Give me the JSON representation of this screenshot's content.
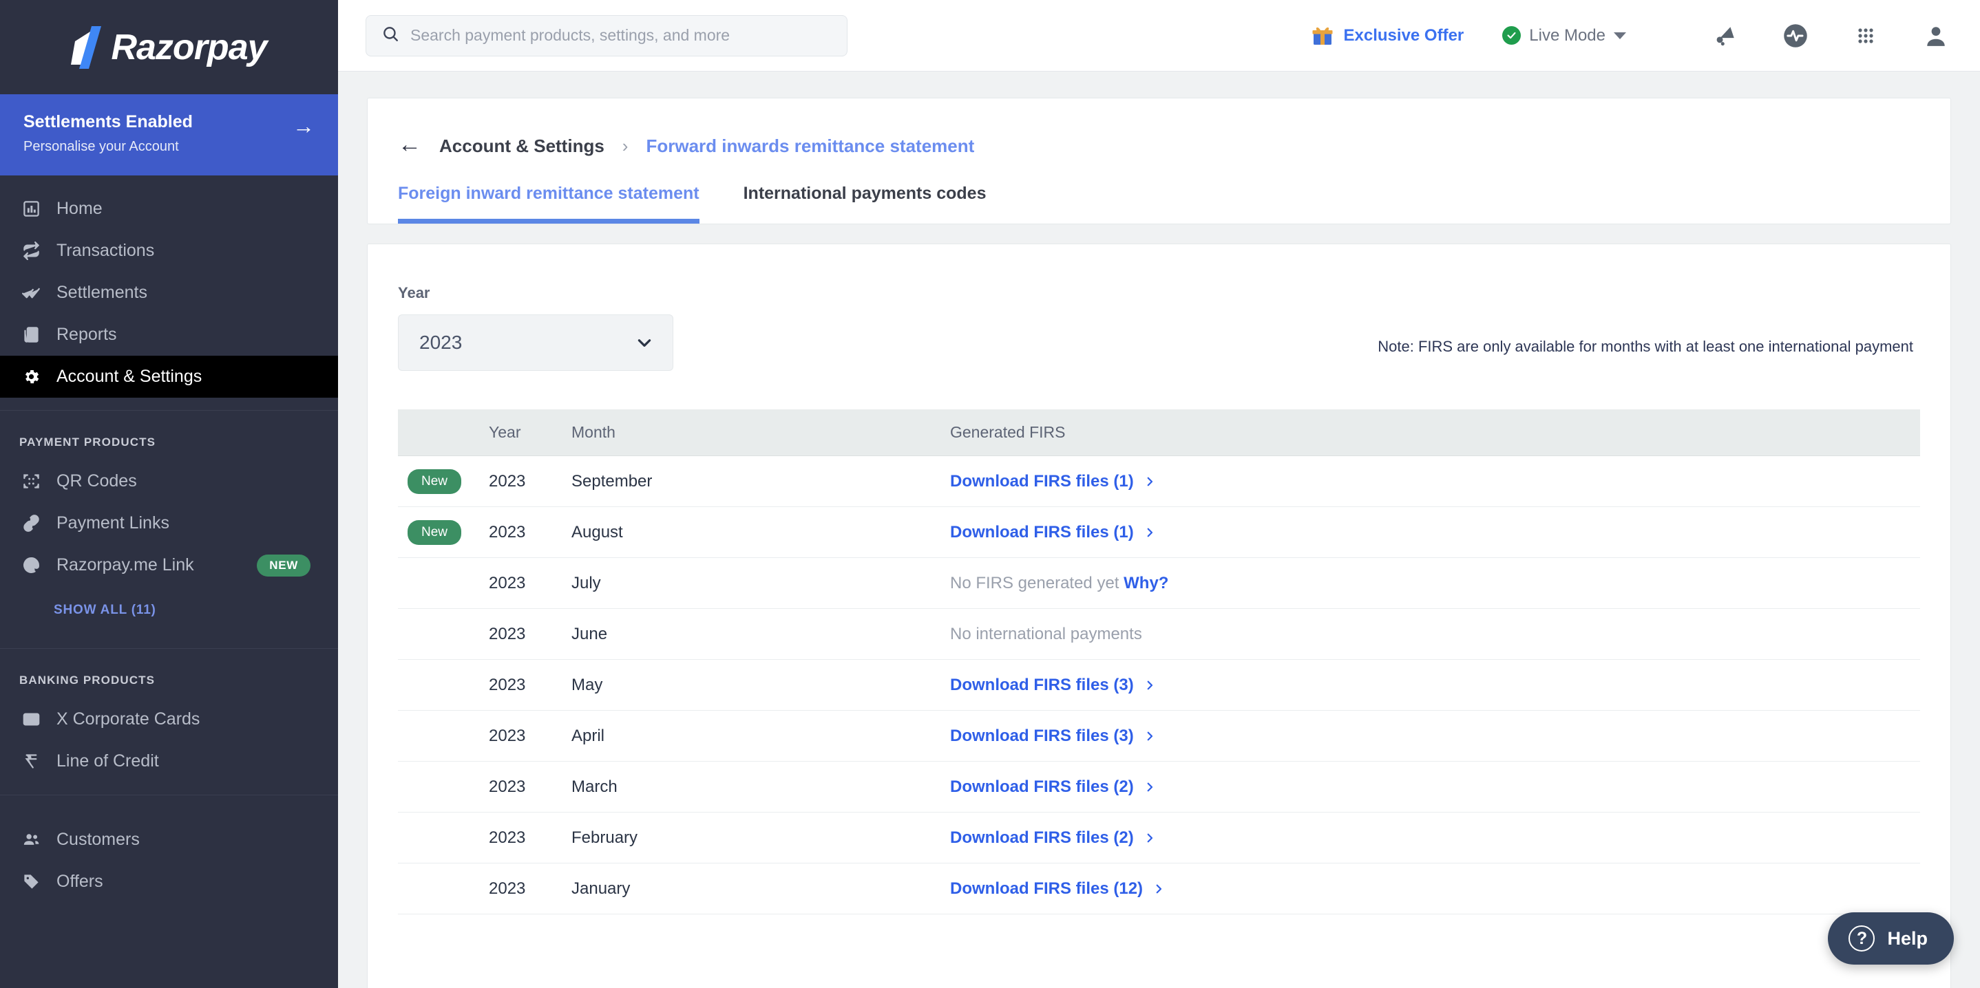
{
  "sidebar": {
    "logo_text": "Razorpay",
    "banner": {
      "title": "Settlements Enabled",
      "subtitle": "Personalise your Account",
      "arrow_icon": "arrow-right-icon"
    },
    "primary_nav": [
      {
        "label": "Home",
        "icon": "dashboard-icon",
        "active": false
      },
      {
        "label": "Transactions",
        "icon": "transactions-icon",
        "active": false
      },
      {
        "label": "Settlements",
        "icon": "double-check-icon",
        "active": false
      },
      {
        "label": "Reports",
        "icon": "reports-icon",
        "active": false
      },
      {
        "label": "Account & Settings",
        "icon": "gear-icon",
        "active": true
      }
    ],
    "payment_products": {
      "title": "PAYMENT PRODUCTS",
      "items": [
        {
          "label": "QR Codes",
          "icon": "qr-code-icon",
          "badge": ""
        },
        {
          "label": "Payment Links",
          "icon": "link-icon",
          "badge": ""
        },
        {
          "label": "Razorpay.me Link",
          "icon": "at-icon",
          "badge": "NEW"
        }
      ],
      "show_all": "SHOW ALL (11)"
    },
    "banking_products": {
      "title": "BANKING PRODUCTS",
      "items": [
        {
          "label": "X Corporate Cards",
          "icon": "credit-card-icon"
        },
        {
          "label": "Line of Credit",
          "icon": "rupee-icon"
        }
      ]
    },
    "other_nav": [
      {
        "label": "Customers",
        "icon": "people-icon"
      },
      {
        "label": "Offers",
        "icon": "tag-icon"
      }
    ]
  },
  "topbar": {
    "search": {
      "placeholder": "Search payment products, settings, and more",
      "value": "",
      "icon": "search-icon"
    },
    "exclusive_offer": {
      "label": "Exclusive Offer",
      "icon": "gift-icon"
    },
    "mode": {
      "label": "Live Mode",
      "status_icon": "check-circle-icon",
      "caret_icon": "chevron-down-icon"
    },
    "icons": [
      {
        "name": "announcement-icon"
      },
      {
        "name": "activity-pulse-icon"
      },
      {
        "name": "apps-grid-icon"
      },
      {
        "name": "user-avatar-icon"
      }
    ]
  },
  "breadcrumb": {
    "back_icon": "arrow-left-icon",
    "parent": "Account & Settings",
    "separator": "›",
    "current": "Forward inwards remittance statement"
  },
  "tabs": [
    {
      "label": "Foreign inward remittance statement",
      "active": true
    },
    {
      "label": "International payments codes",
      "active": false
    }
  ],
  "filters": {
    "year_label": "Year",
    "year_value": "2023",
    "chevron_icon": "chevron-down-icon",
    "note": "Note: FIRS are only available for months with at least one international payment"
  },
  "table": {
    "columns": [
      "",
      "Year",
      "Month",
      "Generated FIRS"
    ],
    "rows": [
      {
        "badge": "New",
        "year": "2023",
        "month": "September",
        "firs_type": "link",
        "firs_text": "Download FIRS files (1)",
        "why": ""
      },
      {
        "badge": "New",
        "year": "2023",
        "month": "August",
        "firs_type": "link",
        "firs_text": "Download FIRS files (1)",
        "why": ""
      },
      {
        "badge": "",
        "year": "2023",
        "month": "July",
        "firs_type": "muted",
        "firs_text": "No FIRS generated yet",
        "why": "Why?"
      },
      {
        "badge": "",
        "year": "2023",
        "month": "June",
        "firs_type": "muted",
        "firs_text": "No international payments",
        "why": ""
      },
      {
        "badge": "",
        "year": "2023",
        "month": "May",
        "firs_type": "link",
        "firs_text": "Download FIRS files (3)",
        "why": ""
      },
      {
        "badge": "",
        "year": "2023",
        "month": "April",
        "firs_type": "link",
        "firs_text": "Download FIRS files (3)",
        "why": ""
      },
      {
        "badge": "",
        "year": "2023",
        "month": "March",
        "firs_type": "link",
        "firs_text": "Download FIRS files (2)",
        "why": ""
      },
      {
        "badge": "",
        "year": "2023",
        "month": "February",
        "firs_type": "link",
        "firs_text": "Download FIRS files (2)",
        "why": ""
      },
      {
        "badge": "",
        "year": "2023",
        "month": "January",
        "firs_type": "link",
        "firs_text": "Download FIRS files (12)",
        "why": ""
      }
    ]
  },
  "help": {
    "label": "Help",
    "icon": "question-circle-icon"
  },
  "colors": {
    "sidebar_bg": "#2D3142",
    "banner_blue": "#3F5BC9",
    "active_nav_bg": "#000000",
    "accent_blue": "#6B8DEF",
    "link_blue": "#2F5FE8",
    "badge_green": "#3C8F63",
    "page_bg": "#F0F2F3",
    "table_head_bg": "#E8ECEC"
  }
}
